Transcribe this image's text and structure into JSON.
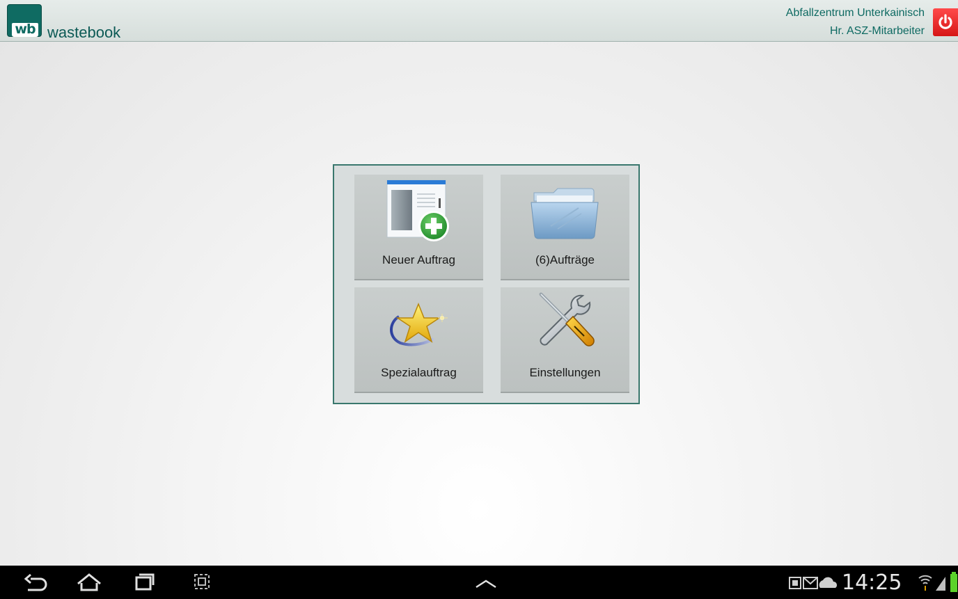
{
  "header": {
    "logo_text": "wb",
    "app_title": "wastebook",
    "organization": "Abfallzentrum Unterkainisch",
    "user": "Hr.  ASZ-Mitarbeiter",
    "power_icon": "power-icon",
    "accent_color": "#0f6b62",
    "power_color": "#e52020"
  },
  "menu": {
    "tiles": [
      {
        "label": "Neuer Auftrag",
        "icon": "new-order-icon"
      },
      {
        "label": "(6)Aufträge",
        "icon": "folder-icon"
      },
      {
        "label": "Spezialauftrag",
        "icon": "star-icon"
      },
      {
        "label": "Einstellungen",
        "icon": "tools-icon"
      }
    ]
  },
  "navbar": {
    "icons": [
      "back-icon",
      "home-icon",
      "recent-apps-icon",
      "screenshot-icon",
      "up-chevron-icon",
      "notification-icons",
      "wifi-icon",
      "signal-icon",
      "battery-icon"
    ],
    "time": "14:25"
  }
}
